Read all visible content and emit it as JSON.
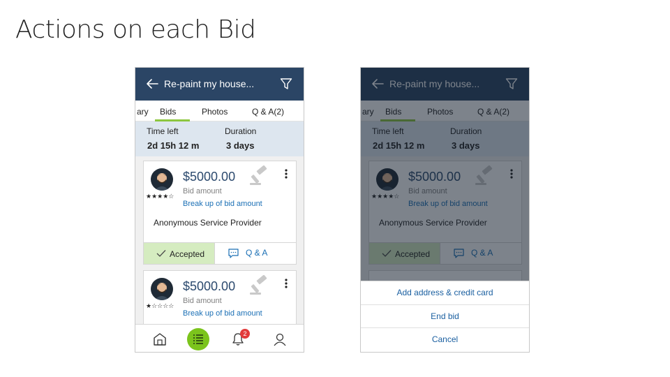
{
  "slide": {
    "title": "Actions on each Bid"
  },
  "screen": {
    "header_title": "Re-paint my house...",
    "tabs": [
      "ary",
      "Bids",
      "Photos",
      "Q & A(2)"
    ],
    "active_tab": "Bids",
    "time_left_label": "Time left",
    "time_left_value": "2d 15h 12 m",
    "duration_label": "Duration",
    "duration_value": "3 days",
    "bids": [
      {
        "amount": "$5000.00",
        "amount_label": "Bid amount",
        "breakup_link": "Break up of bid amount",
        "provider": "Anonymous Service Provider",
        "rating": 4,
        "stars_text": "★★★★☆",
        "status_label": "Accepted",
        "qa_label": "Q & A"
      },
      {
        "amount": "$5000.00",
        "amount_label": "Bid amount",
        "breakup_link": "Break up of bid amount",
        "rating": 1,
        "stars_text": "★☆☆☆☆"
      }
    ],
    "nav": {
      "items": [
        "home-icon",
        "list-icon",
        "bell-icon",
        "profile-icon"
      ],
      "active": "list-icon",
      "notification_count": "2"
    }
  },
  "action_sheet": {
    "items": [
      "Add address & credit card",
      "End bid",
      "Cancel"
    ]
  },
  "colors": {
    "app_bar": "#2b4565",
    "accent_green": "#8cc63f",
    "nav_active": "#7bc41c",
    "link_blue": "#1a6fb5",
    "accepted_bg": "#d5ecc0",
    "badge_red": "#e23b3b"
  }
}
